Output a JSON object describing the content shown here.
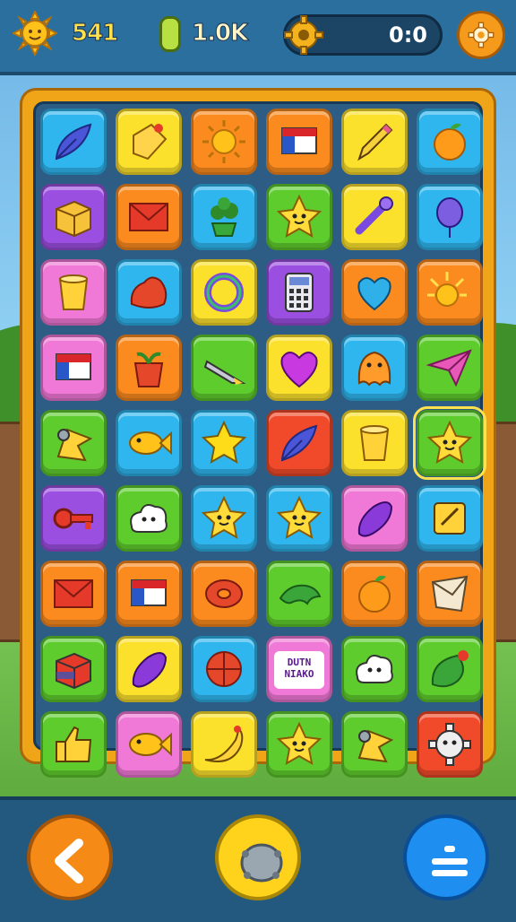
{
  "hud": {
    "score": "541",
    "coins": "1.0K",
    "timer": "0:0",
    "progress_fraction": 0.0
  },
  "colors": {
    "blue": "#2fb6ef",
    "yellow": "#fbe02c",
    "orange": "#fb8a1f",
    "green": "#5fcc2e",
    "purple": "#9b4fe0",
    "pink": "#f078d6",
    "red": "#f04a2a"
  },
  "board": {
    "rows": 9,
    "cols": 6,
    "tiles": [
      {
        "color": "blue",
        "icon": "feather-icon"
      },
      {
        "color": "yellow",
        "icon": "tag-icon"
      },
      {
        "color": "orange",
        "icon": "sun-icon"
      },
      {
        "color": "orange",
        "icon": "flag-icon"
      },
      {
        "color": "yellow",
        "icon": "pencil-icon"
      },
      {
        "color": "blue",
        "icon": "fruit-icon"
      },
      {
        "color": "purple",
        "icon": "box-icon"
      },
      {
        "color": "orange",
        "icon": "envelope-icon"
      },
      {
        "color": "blue",
        "icon": "plant-icon"
      },
      {
        "color": "green",
        "icon": "star-creature-icon"
      },
      {
        "color": "yellow",
        "icon": "wrench-icon"
      },
      {
        "color": "blue",
        "icon": "balloon-icon"
      },
      {
        "color": "pink",
        "icon": "cup-icon"
      },
      {
        "color": "blue",
        "icon": "blob-icon"
      },
      {
        "color": "yellow",
        "icon": "ring-icon"
      },
      {
        "color": "purple",
        "icon": "calculator-icon"
      },
      {
        "color": "orange",
        "icon": "heart-shield-icon"
      },
      {
        "color": "orange",
        "icon": "sunburst-icon"
      },
      {
        "color": "pink",
        "icon": "flag-icon"
      },
      {
        "color": "orange",
        "icon": "flowerpot-icon"
      },
      {
        "color": "green",
        "icon": "crayon-icon"
      },
      {
        "color": "yellow",
        "icon": "heart-icon"
      },
      {
        "color": "blue",
        "icon": "blob-creature-icon"
      },
      {
        "color": "green",
        "icon": "paper-plane-icon"
      },
      {
        "color": "green",
        "icon": "bird-icon"
      },
      {
        "color": "blue",
        "icon": "fish-icon"
      },
      {
        "color": "blue",
        "icon": "star-icon"
      },
      {
        "color": "red",
        "icon": "feather-icon"
      },
      {
        "color": "yellow",
        "icon": "cup-icon"
      },
      {
        "color": "green",
        "icon": "star-creature-icon",
        "selected": true
      },
      {
        "color": "purple",
        "icon": "key-icon"
      },
      {
        "color": "green",
        "icon": "cloud-creature-icon"
      },
      {
        "color": "blue",
        "icon": "star-creature-icon"
      },
      {
        "color": "blue",
        "icon": "star-creature-icon"
      },
      {
        "color": "pink",
        "icon": "bean-icon"
      },
      {
        "color": "blue",
        "icon": "note-icon"
      },
      {
        "color": "orange",
        "icon": "envelope-icon"
      },
      {
        "color": "orange",
        "icon": "flag-icon"
      },
      {
        "color": "orange",
        "icon": "donut-icon"
      },
      {
        "color": "green",
        "icon": "dolphin-icon"
      },
      {
        "color": "orange",
        "icon": "fruit-icon"
      },
      {
        "color": "orange",
        "icon": "paper-icon"
      },
      {
        "color": "green",
        "icon": "cube-icon"
      },
      {
        "color": "yellow",
        "icon": "bean-icon"
      },
      {
        "color": "blue",
        "icon": "ball-icon"
      },
      {
        "color": "pink",
        "icon": "text-sign-icon",
        "text": "DUTN\nNIAKO"
      },
      {
        "color": "green",
        "icon": "cloud-creature-icon"
      },
      {
        "color": "green",
        "icon": "leaf-icon"
      },
      {
        "color": "green",
        "icon": "thumbs-up-icon"
      },
      {
        "color": "pink",
        "icon": "fish-icon"
      },
      {
        "color": "yellow",
        "icon": "banana-icon"
      },
      {
        "color": "green",
        "icon": "star-creature-icon"
      },
      {
        "color": "green",
        "icon": "bird-icon"
      },
      {
        "color": "red",
        "icon": "gear-creature-icon"
      }
    ]
  },
  "buttons": {
    "back": {
      "icon": "back-arrow-icon"
    },
    "center": {
      "icon": "boulder-icon"
    },
    "shuffle": {
      "icon": "divide-icon"
    }
  }
}
